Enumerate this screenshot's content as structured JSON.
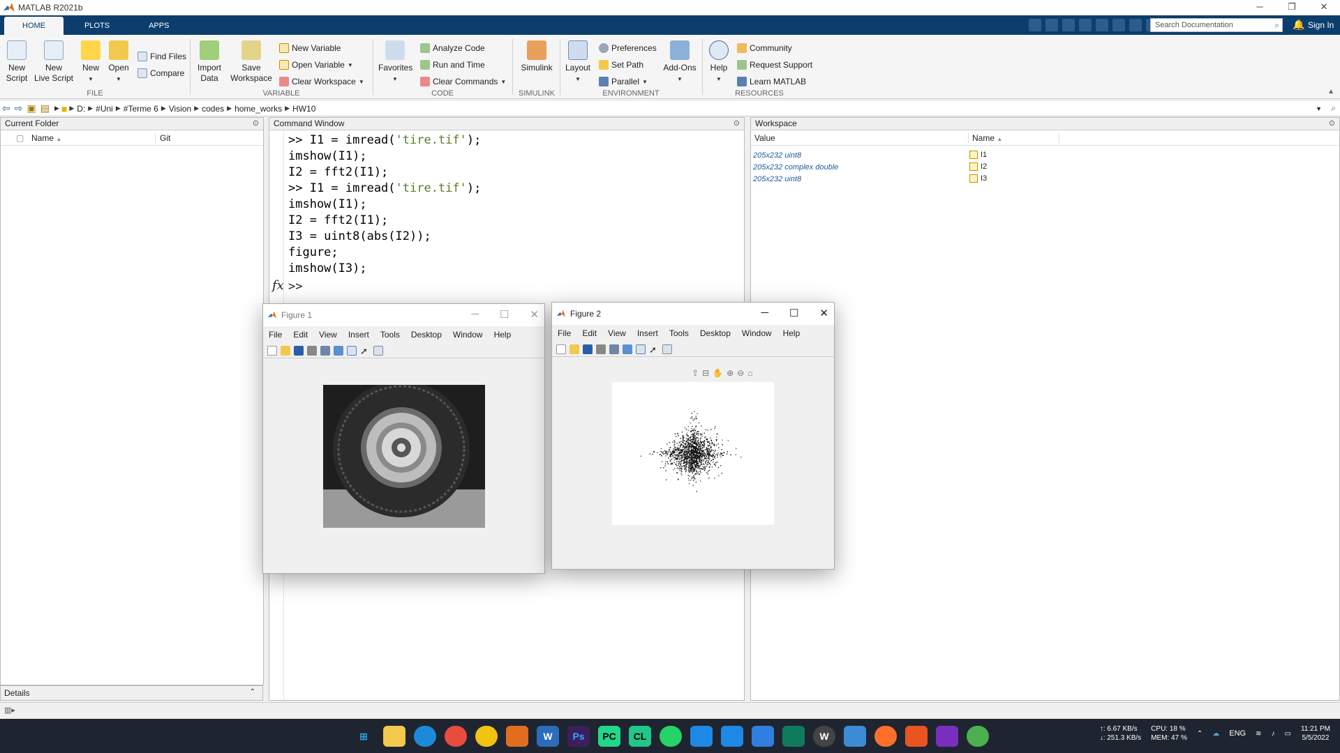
{
  "window": {
    "title": "MATLAB R2021b"
  },
  "tabs": [
    "HOME",
    "PLOTS",
    "APPS"
  ],
  "search": {
    "placeholder": "Search Documentation"
  },
  "signin": "Sign In",
  "ribbon": {
    "file": {
      "label": "FILE",
      "new_script": "New\nScript",
      "new_live_script": "New\nLive Script",
      "new": "New",
      "open": "Open",
      "find_files": "Find Files",
      "compare": "Compare"
    },
    "variable": {
      "label": "VARIABLE",
      "import_data": "Import\nData",
      "save_workspace": "Save\nWorkspace",
      "new_variable": "New Variable",
      "open_variable": "Open Variable",
      "clear_workspace": "Clear Workspace"
    },
    "code": {
      "label": "CODE",
      "favorites": "Favorites",
      "analyze_code": "Analyze Code",
      "run_and_time": "Run and Time",
      "clear_commands": "Clear Commands"
    },
    "simulink": {
      "label": "SIMULINK",
      "simulink": "Simulink"
    },
    "environment": {
      "label": "ENVIRONMENT",
      "layout": "Layout",
      "preferences": "Preferences",
      "set_path": "Set Path",
      "parallel": "Parallel",
      "add_ons": "Add-Ons"
    },
    "resources": {
      "label": "RESOURCES",
      "help": "Help",
      "community": "Community",
      "request_support": "Request Support",
      "learn_matlab": "Learn MATLAB"
    }
  },
  "address": [
    "D:",
    "#Uni",
    "#Terme 6",
    "Vision",
    "codes",
    "home_works",
    "HW10"
  ],
  "current_folder": {
    "title": "Current Folder",
    "col_name": "Name",
    "col_git": "Git",
    "details": "Details"
  },
  "command_window": {
    "title": "Command Window",
    "lines": [
      {
        "pre": ">> I1 = imread(",
        "str": "'tire.tif'",
        "post": ");"
      },
      {
        "pre": "imshow(I1);",
        "str": "",
        "post": ""
      },
      {
        "pre": "I2 = fft2(I1);",
        "str": "",
        "post": ""
      },
      {
        "pre": ">> I1 = imread(",
        "str": "'tire.tif'",
        "post": ");"
      },
      {
        "pre": "imshow(I1);",
        "str": "",
        "post": ""
      },
      {
        "pre": "I2 = fft2(I1);",
        "str": "",
        "post": ""
      },
      {
        "pre": "I3 = uint8(abs(I2));",
        "str": "",
        "post": ""
      },
      {
        "pre": "figure;",
        "str": "",
        "post": ""
      },
      {
        "pre": "imshow(I3);",
        "str": "",
        "post": ""
      }
    ],
    "prompt": ">>",
    "fx": "fx"
  },
  "workspace": {
    "title": "Workspace",
    "col_value": "Value",
    "col_name": "Name",
    "rows": [
      {
        "value": "205x232 uint8",
        "name": "I1"
      },
      {
        "value": "205x232 complex double",
        "name": "I2"
      },
      {
        "value": "205x232 uint8",
        "name": "I3"
      }
    ]
  },
  "figure1": {
    "title": "Figure 1"
  },
  "figure2": {
    "title": "Figure 2"
  },
  "fig_menu": [
    "File",
    "Edit",
    "View",
    "Insert",
    "Tools",
    "Desktop",
    "Window",
    "Help"
  ],
  "tray": {
    "net_up": "↑: 6.67 KB/s",
    "net_down": "↓: 251.3 KB/s",
    "cpu": "CPU: 18 %",
    "mem": "MEM: 47 %",
    "lang": "ENG",
    "time": "11:21 PM",
    "date": "5/5/2022"
  },
  "colors": {
    "titlebar_blue": "#0c3e6d",
    "code_string": "#a020f0",
    "taskbar": "#1f2530"
  }
}
